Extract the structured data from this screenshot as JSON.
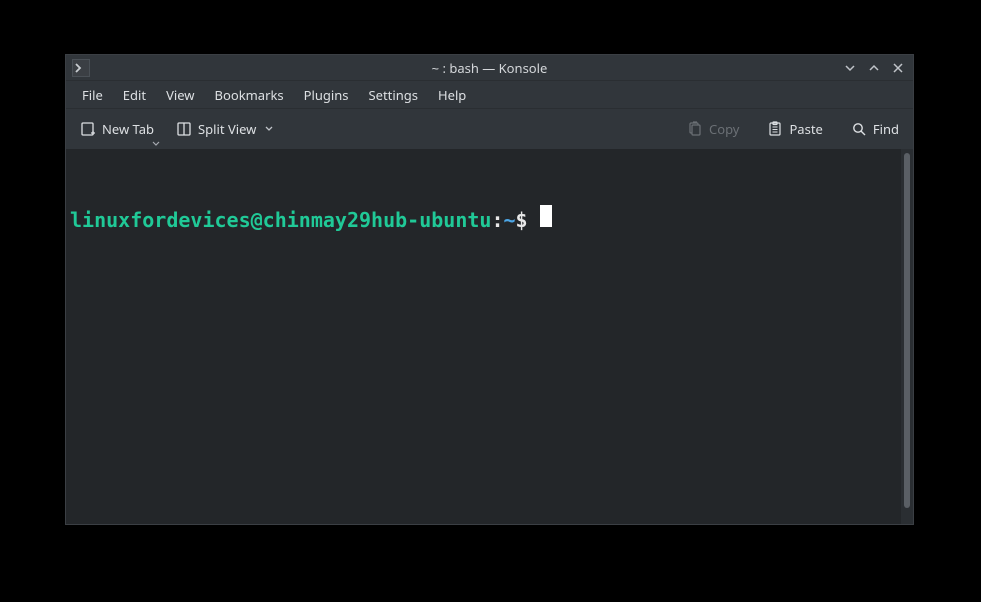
{
  "window": {
    "title": "~ : bash — Konsole"
  },
  "menubar": {
    "items": [
      "File",
      "Edit",
      "View",
      "Bookmarks",
      "Plugins",
      "Settings",
      "Help"
    ]
  },
  "toolbar": {
    "new_tab_label": "New Tab",
    "split_view_label": "Split View",
    "copy_label": "Copy",
    "paste_label": "Paste",
    "find_label": "Find"
  },
  "terminal": {
    "user_host": "linuxfordevices@chinmay29hub-ubuntu",
    "colon": ":",
    "cwd": "~",
    "prompt_symbol": "$"
  }
}
